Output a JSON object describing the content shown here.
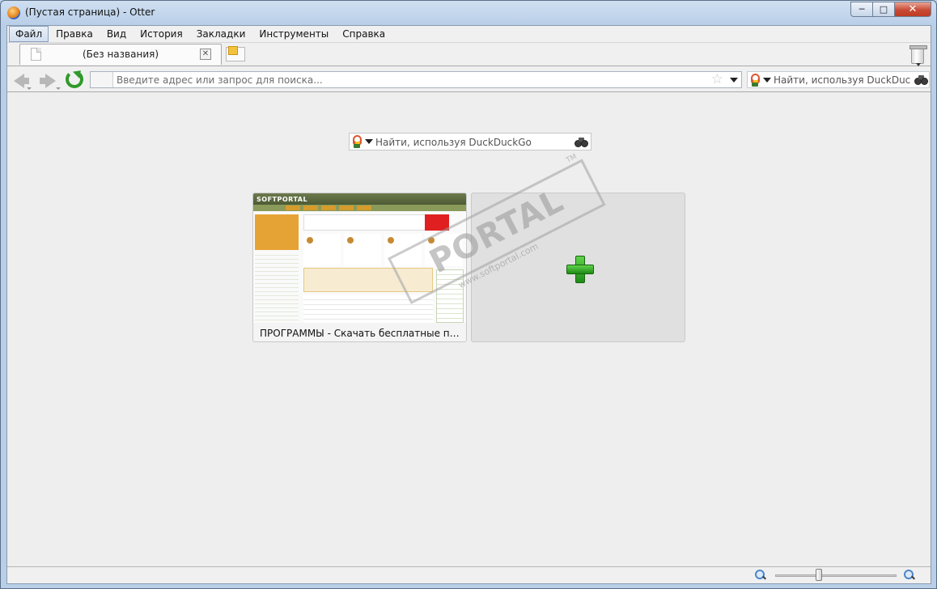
{
  "window": {
    "title": "(Пустая страница) - Otter"
  },
  "menu": [
    "Файл",
    "Правка",
    "Вид",
    "История",
    "Закладки",
    "Инструменты",
    "Справка"
  ],
  "tabs": [
    {
      "title": "(Без названия)"
    }
  ],
  "toolbar": {
    "address_placeholder": "Введите адрес или запрос для поиска...",
    "search_placeholder": "Найти, используя DuckDuckGo"
  },
  "speed_dial": {
    "search_placeholder": "Найти, используя DuckDuckGo",
    "tiles": [
      {
        "title": "ПРОГРАММЫ - Скачать бесплатные прог...",
        "thumb_logo": "SOFTPORTAL"
      }
    ]
  },
  "watermark": {
    "text": "PORTAL",
    "sub": "www.softportal.com",
    "tm": "TM"
  },
  "zoom": {
    "level": 0.35
  },
  "colors": {
    "accent": "#3a6fc0",
    "plus": "#2fa42a"
  }
}
